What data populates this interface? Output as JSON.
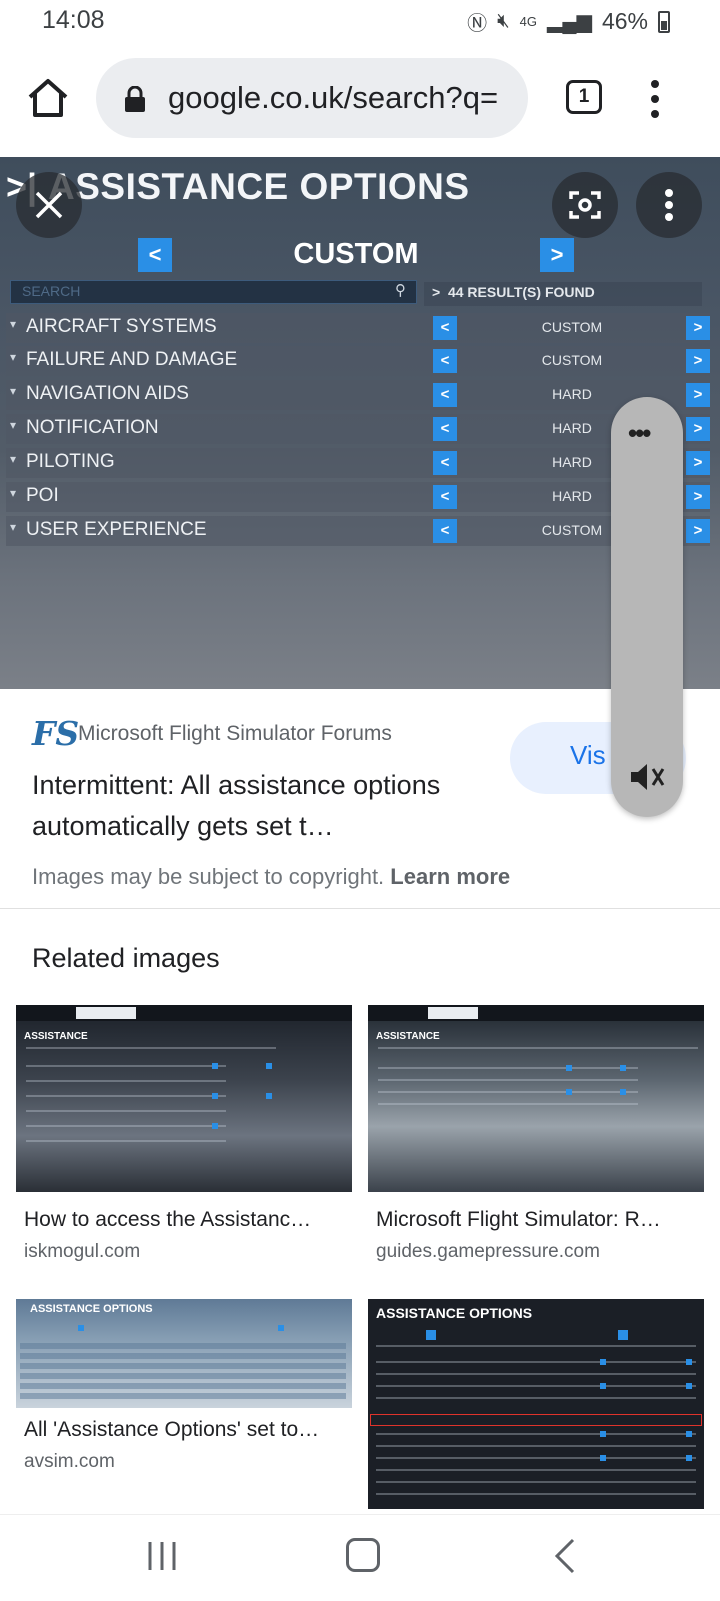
{
  "status_bar": {
    "time": "14:08",
    "network": "4G",
    "battery": "46%"
  },
  "browser": {
    "url": "google.co.uk/search?q=",
    "tab_count": "1"
  },
  "preview": {
    "title": "ASSISTANCE OPTIONS",
    "preset": "CUSTOM",
    "search_placeholder": "SEARCH",
    "results": "44 RESULT(S) FOUND",
    "categories": [
      {
        "name": "AIRCRAFT SYSTEMS",
        "value": "CUSTOM"
      },
      {
        "name": "FAILURE AND DAMAGE",
        "value": "CUSTOM"
      },
      {
        "name": "NAVIGATION AIDS",
        "value": "HARD"
      },
      {
        "name": "NOTIFICATION",
        "value": "HARD"
      },
      {
        "name": "PILOTING",
        "value": "HARD"
      },
      {
        "name": "POI",
        "value": "HARD"
      },
      {
        "name": "USER EXPERIENCE",
        "value": "CUSTOM"
      }
    ]
  },
  "source": {
    "logo": "FS",
    "name": "Microsoft Flight Simulator Forums",
    "visit_label": "Vis",
    "title": "Intermittent: All assistance options automatically gets set t…",
    "copyright_text": "Images may be subject to copyright.",
    "learn_more": "Learn more"
  },
  "related": {
    "heading": "Related images",
    "items": [
      {
        "title": "How to access the Assistanc…",
        "site": "iskmogul.com",
        "thumb_label": "ASSISTANCE"
      },
      {
        "title": "Microsoft Flight Simulator: R…",
        "site": "guides.gamepressure.com",
        "thumb_label": "ASSISTANCE"
      },
      {
        "title": "All 'Assistance Options' set to…",
        "site": "avsim.com",
        "thumb_label": "ASSISTANCE OPTIONS"
      },
      {
        "title": "",
        "site": "",
        "thumb_label": "ASSISTANCE OPTIONS"
      }
    ]
  },
  "colors": {
    "accent_blue": "#2a8fe6",
    "link_blue": "#1a73e8"
  }
}
